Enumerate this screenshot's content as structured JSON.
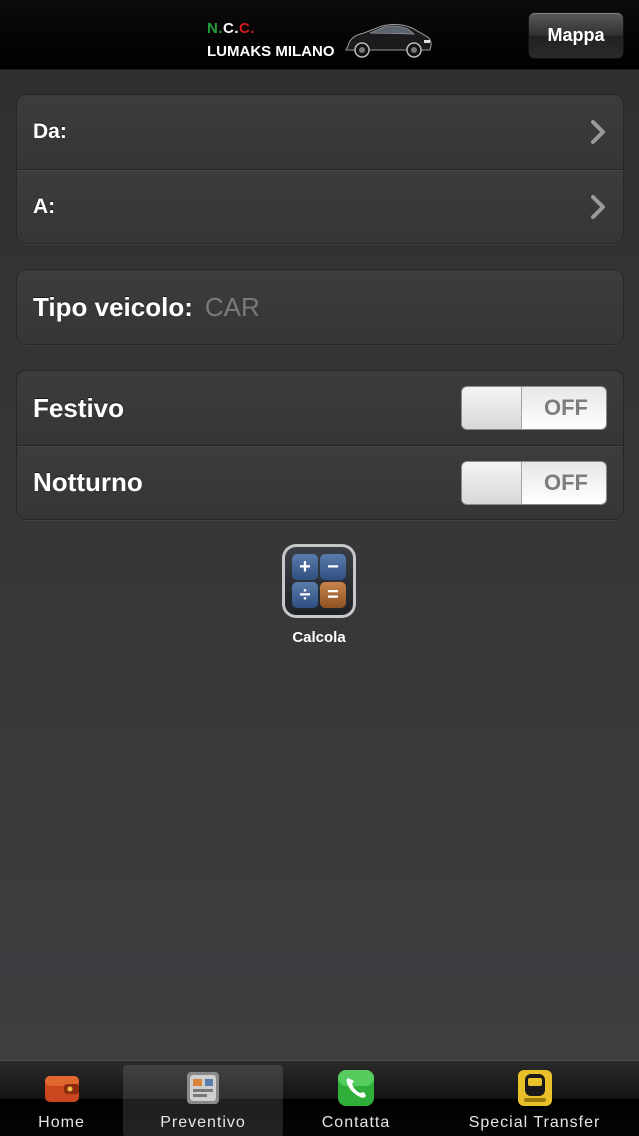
{
  "navbar": {
    "logo": {
      "ncc_n": "N.",
      "ncc_c1": "C.",
      "ncc_c2": "C.",
      "name": "LUMAKS MILANO"
    },
    "map_button_label": "Mappa"
  },
  "route": {
    "from_label": "Da:",
    "to_label": "A:"
  },
  "vehicle": {
    "label": "Tipo veicolo:",
    "value": "CAR"
  },
  "options": {
    "festivo": {
      "label": "Festivo",
      "state": "OFF"
    },
    "notturno": {
      "label": "Notturno",
      "state": "OFF"
    }
  },
  "calc": {
    "label": "Calcola",
    "keys": [
      "+",
      "−",
      "÷",
      "="
    ]
  },
  "tabbar": {
    "items": [
      {
        "label": "Home",
        "icon": "wallet-icon"
      },
      {
        "label": "Preventivo",
        "icon": "quote-icon",
        "active": true
      },
      {
        "label": "Contatta",
        "icon": "phone-icon"
      },
      {
        "label": "Special Transfer",
        "icon": "taxi-icon"
      }
    ]
  },
  "colors": {
    "accent_green": "#1f9e3a",
    "accent_red": "#d61b1b",
    "background": "#3a3a3c"
  }
}
